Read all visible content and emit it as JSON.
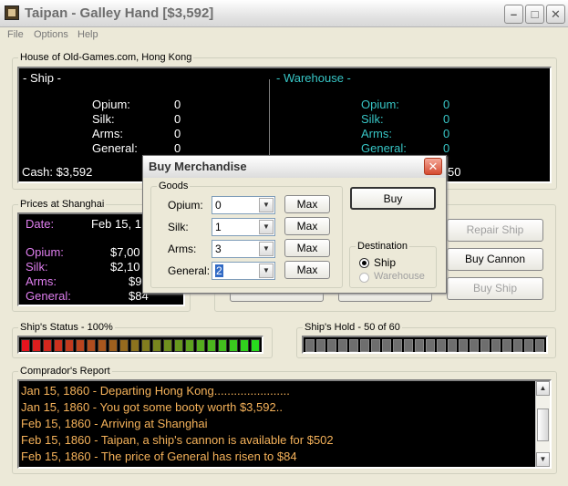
{
  "window": {
    "title": "Taipan - Galley Hand [$3,592]"
  },
  "menu": [
    "File",
    "Options",
    "Help"
  ],
  "house": {
    "label": "House of Old-Games.com, Hong Kong",
    "ship_heading": "- Ship -",
    "warehouse_heading": "- Warehouse -",
    "ship": [
      {
        "name": "Opium:",
        "value": "0"
      },
      {
        "name": "Silk:",
        "value": "0"
      },
      {
        "name": "Arms:",
        "value": "0"
      },
      {
        "name": "General:",
        "value": "0"
      }
    ],
    "warehouse": [
      {
        "name": "Opium:",
        "value": "0"
      },
      {
        "name": "Silk:",
        "value": "0"
      },
      {
        "name": "Arms:",
        "value": "0"
      },
      {
        "name": "General:",
        "value": "0"
      }
    ],
    "cash": "Cash: $3,592",
    "bank_partial": "50"
  },
  "prices": {
    "label": "Prices at Shanghai",
    "date_label": "Date:",
    "date_value": "Feb 15, 1",
    "items": [
      {
        "name": "Opium:",
        "value": "$7,00"
      },
      {
        "name": "Silk:",
        "value": "$2,10"
      },
      {
        "name": "Arms:",
        "value": "$9"
      },
      {
        "name": "General:",
        "value": "$84"
      }
    ]
  },
  "actions": {
    "repair_ship": "Repair Ship",
    "buy_cannon": "Buy Cannon",
    "buy_ship": "Buy Ship"
  },
  "status": {
    "label": "Ship's Status - 100%",
    "level": 1.0
  },
  "hold": {
    "label": "Ship's Hold - 50 of 60",
    "level": 0
  },
  "report": {
    "label": "Comprador's Report",
    "lines": [
      "Jan 15, 1860 - Departing Hong Kong.......................",
      "Jan 15, 1860 - You got some booty worth $3,592..",
      "Feb 15, 1860 - Arriving at Shanghai",
      "Feb 15, 1860 - Taipan, a ship's cannon is available for $502",
      "Feb 15, 1860 - The price of General has risen to $84"
    ]
  },
  "dialog": {
    "title": "Buy Merchandise",
    "goods_label": "Goods",
    "rows": [
      {
        "label": "Opium:",
        "value": "0"
      },
      {
        "label": "Silk:",
        "value": "1"
      },
      {
        "label": "Arms:",
        "value": "3"
      },
      {
        "label": "General:",
        "value": "2"
      }
    ],
    "max_label": "Max",
    "buy_label": "Buy",
    "destination_label": "Destination",
    "dest_ship": "Ship",
    "dest_warehouse": "Warehouse"
  }
}
